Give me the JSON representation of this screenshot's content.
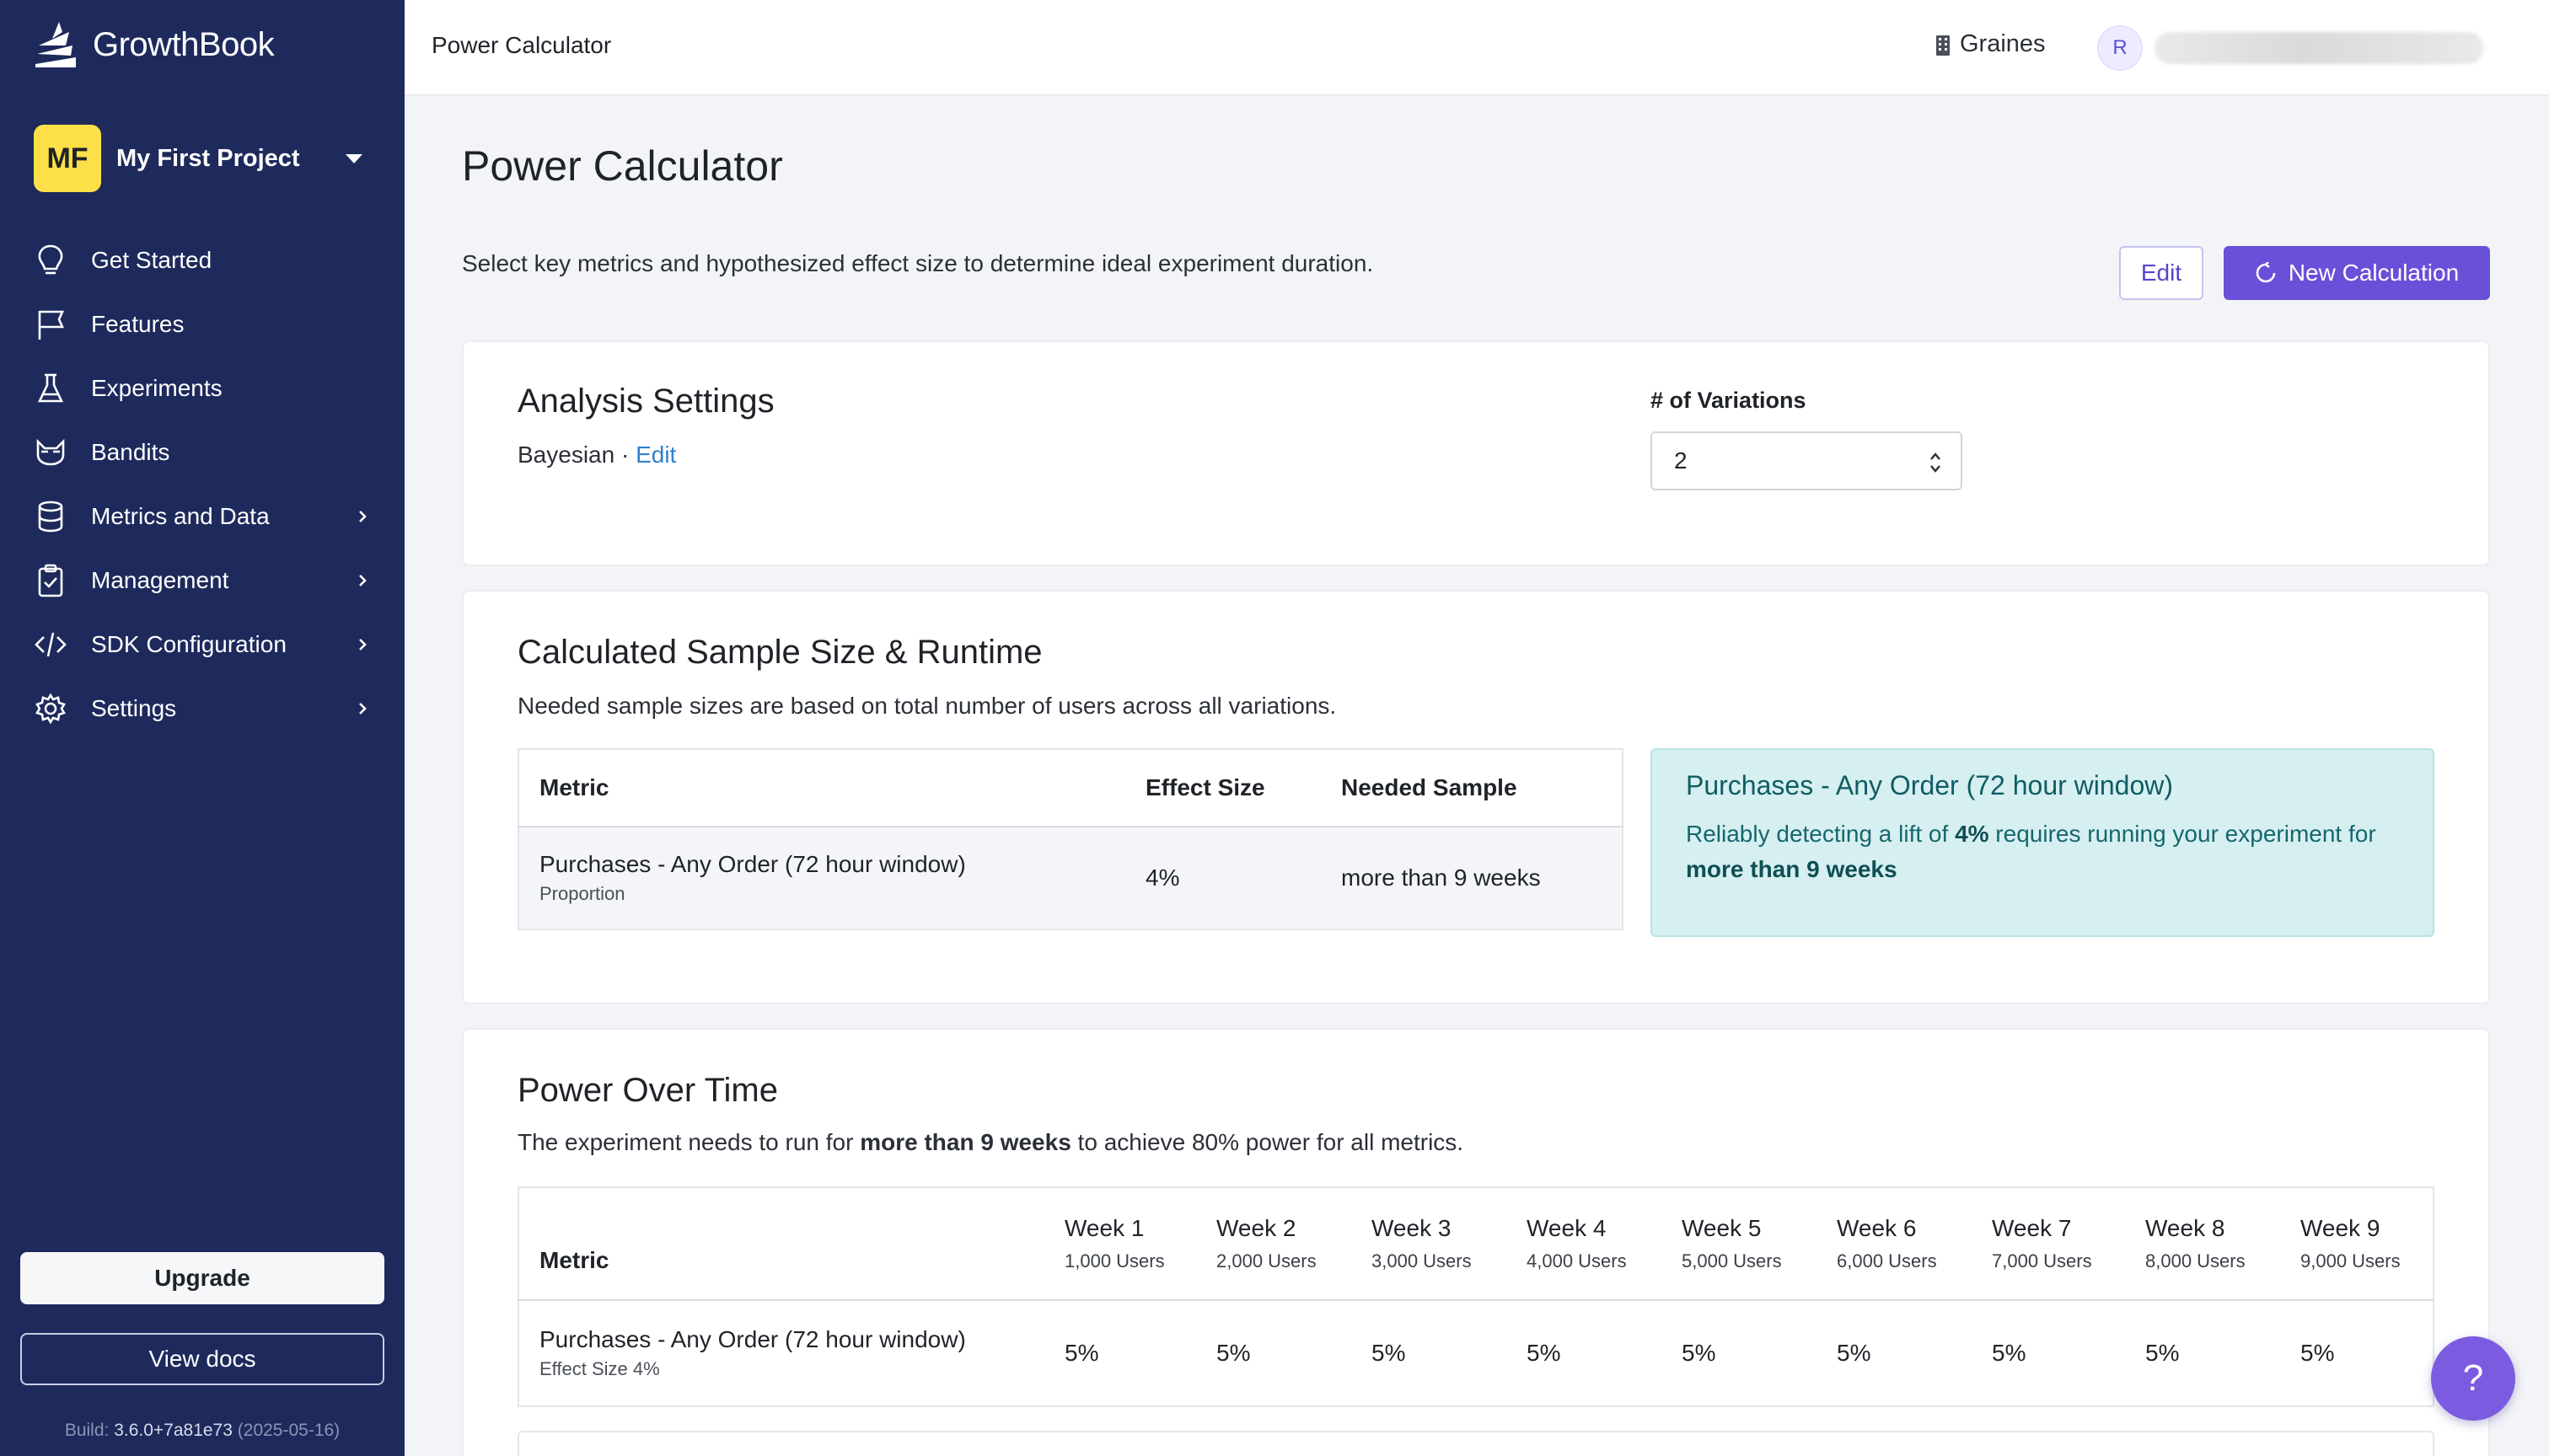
{
  "brand": {
    "name": "GrowthBook",
    "accent": "#6a4fd8",
    "sidebar_bg": "#1e2a5c"
  },
  "project": {
    "initials": "MF",
    "name": "My First Project"
  },
  "nav": [
    {
      "label": "Get Started",
      "icon": "lightbulb-icon",
      "expandable": false
    },
    {
      "label": "Features",
      "icon": "flag-icon",
      "expandable": false
    },
    {
      "label": "Experiments",
      "icon": "flask-icon",
      "expandable": false
    },
    {
      "label": "Bandits",
      "icon": "bandit-icon",
      "expandable": false
    },
    {
      "label": "Metrics and Data",
      "icon": "database-icon",
      "expandable": true
    },
    {
      "label": "Management",
      "icon": "clipboard-icon",
      "expandable": true
    },
    {
      "label": "SDK Configuration",
      "icon": "code-icon",
      "expandable": true
    },
    {
      "label": "Settings",
      "icon": "gear-icon",
      "expandable": true
    }
  ],
  "sidebar_footer": {
    "upgrade": "Upgrade",
    "docs": "View docs",
    "build_prefix": "Build:",
    "build_version": "3.6.0+7a81e73",
    "build_date": "(2025-05-16)"
  },
  "topbar": {
    "title": "Power Calculator",
    "org": "Graines",
    "user_initial": "R"
  },
  "page": {
    "title": "Power Calculator",
    "description": "Select key metrics and hypothesized effect size to determine ideal experiment duration.",
    "edit_button": "Edit",
    "new_button": "New Calculation"
  },
  "analysis": {
    "title": "Analysis Settings",
    "engine": "Bayesian",
    "separator": " · ",
    "edit_link": "Edit",
    "variations_label": "# of Variations",
    "variations_value": "2"
  },
  "sample": {
    "title": "Calculated Sample Size & Runtime",
    "subtitle": "Needed sample sizes are based on total number of users across all variations.",
    "headers": {
      "metric": "Metric",
      "effect": "Effect Size",
      "needed": "Needed Sample"
    },
    "row": {
      "metric": "Purchases - Any Order (72 hour window)",
      "metric_type": "Proportion",
      "effect": "4%",
      "needed": "more than 9 weeks"
    },
    "callout": {
      "title": "Purchases - Any Order (72 hour window)",
      "text_1": "Reliably detecting a lift of ",
      "lift": "4%",
      "text_2": " requires running your experiment for ",
      "duration": "more than 9 weeks"
    }
  },
  "power": {
    "title": "Power Over Time",
    "text_1": "The experiment needs to run for ",
    "duration": "more than 9 weeks",
    "text_2": " to achieve 80% power for all metrics.",
    "metric_header": "Metric",
    "weeks": [
      {
        "label": "Week 1",
        "users": "1,000 Users"
      },
      {
        "label": "Week 2",
        "users": "2,000 Users"
      },
      {
        "label": "Week 3",
        "users": "3,000 Users"
      },
      {
        "label": "Week 4",
        "users": "4,000 Users"
      },
      {
        "label": "Week 5",
        "users": "5,000 Users"
      },
      {
        "label": "Week 6",
        "users": "6,000 Users"
      },
      {
        "label": "Week 7",
        "users": "7,000 Users"
      },
      {
        "label": "Week 8",
        "users": "8,000 Users"
      },
      {
        "label": "Week 9",
        "users": "9,000 Users"
      }
    ],
    "row": {
      "metric": "Purchases - Any Order (72 hour window)",
      "effect": "Effect Size 4%",
      "values": [
        "5%",
        "5%",
        "5%",
        "5%",
        "5%",
        "5%",
        "5%",
        "5%",
        "5%"
      ]
    }
  },
  "help": {
    "label": "?"
  }
}
